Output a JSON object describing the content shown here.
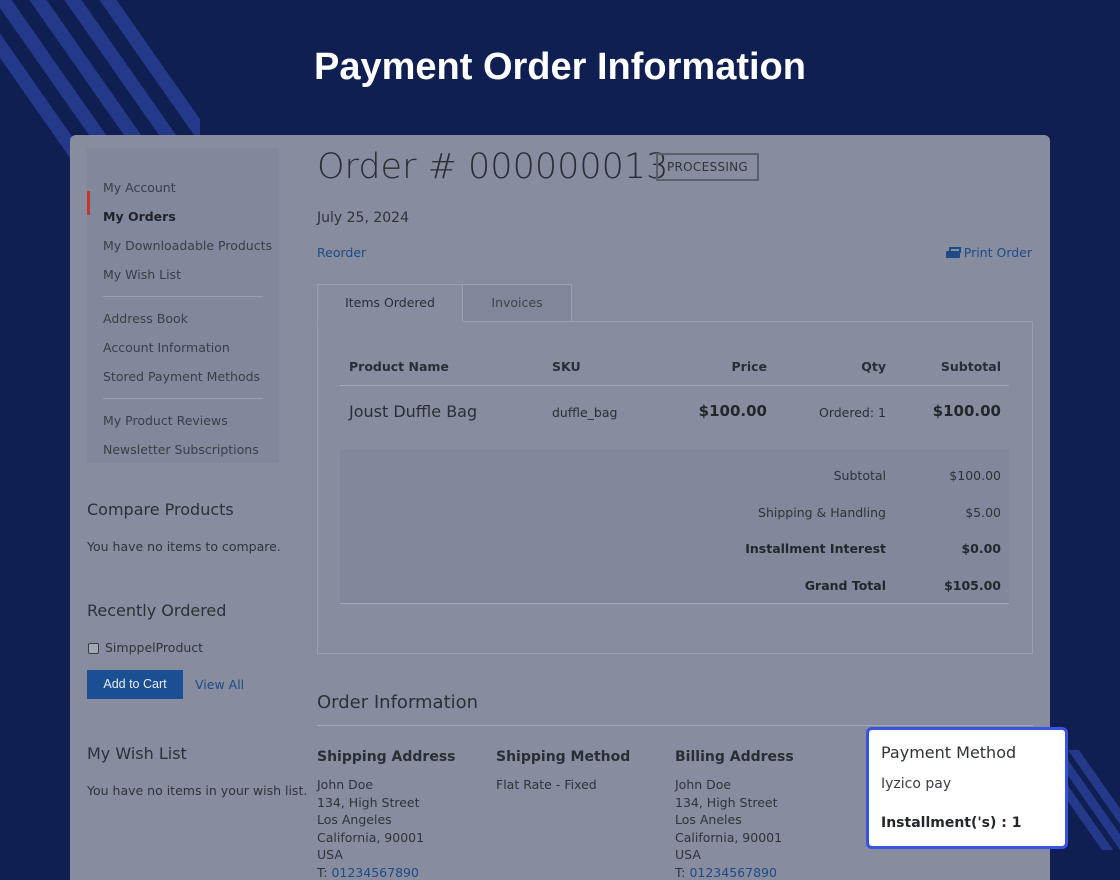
{
  "hero": {
    "title": "Payment Order Information"
  },
  "sidebar": {
    "items": [
      {
        "label": "My Account",
        "active": false
      },
      {
        "label": "My Orders",
        "active": true
      },
      {
        "label": "My Downloadable Products",
        "active": false
      },
      {
        "label": "My Wish List",
        "active": false
      },
      {
        "label": "Address Book",
        "active": false
      },
      {
        "label": "Account Information",
        "active": false
      },
      {
        "label": "Stored Payment Methods",
        "active": false
      },
      {
        "label": "My Product Reviews",
        "active": false
      },
      {
        "label": "Newsletter Subscriptions",
        "active": false
      }
    ]
  },
  "compare": {
    "title": "Compare Products",
    "empty_text": "You have no items to compare."
  },
  "recently_ordered": {
    "title": "Recently Ordered",
    "product": "SimppelProduct",
    "add_to_cart": "Add to Cart",
    "view_all": "View All"
  },
  "wishlist": {
    "title": "My Wish List",
    "empty_text": "You have no items in your wish list."
  },
  "order": {
    "title": "Order # 000000013",
    "status": "PROCESSING",
    "date": "July 25, 2024",
    "reorder": "Reorder",
    "print": "Print Order"
  },
  "tabs": [
    {
      "label": "Items Ordered",
      "active": true
    },
    {
      "label": "Invoices",
      "active": false
    }
  ],
  "items_table": {
    "headers": {
      "product": "Product Name",
      "sku": "SKU",
      "price": "Price",
      "qty": "Qty",
      "subtotal": "Subtotal"
    },
    "rows": [
      {
        "product": "Joust Duffle Bag",
        "sku": "duffle_bag",
        "price": "$100.00",
        "qty": "Ordered: 1",
        "subtotal": "$100.00"
      }
    ]
  },
  "totals": [
    {
      "label": "Subtotal",
      "value": "$100.00",
      "bold": false
    },
    {
      "label": "Shipping & Handling",
      "value": "$5.00",
      "bold": false
    },
    {
      "label": "Installment Interest",
      "value": "$0.00",
      "bold": true
    },
    {
      "label": "Grand Total",
      "value": "$105.00",
      "bold": true
    }
  ],
  "order_info": {
    "title": "Order Information",
    "shipping_address": {
      "heading": "Shipping Address",
      "lines": [
        "John Doe",
        "134, High Street",
        "Los Angeles",
        "California, 90001",
        "USA"
      ],
      "phone_prefix": "T: ",
      "phone": "01234567890"
    },
    "shipping_method": {
      "heading": "Shipping Method",
      "value": "Flat Rate - Fixed"
    },
    "billing_address": {
      "heading": "Billing Address",
      "lines": [
        "John Doe",
        "134, High Street",
        "Los Aneles",
        "California, 90001",
        "USA"
      ],
      "phone_prefix": "T: ",
      "phone": "01234567890"
    },
    "payment_method": {
      "heading": "Payment Method",
      "value": "Iyzico pay",
      "installment": "Installment('s) : 1"
    }
  },
  "colors": {
    "background": "#101f52",
    "accent_border": "#3753e0",
    "link": "#1e4a88",
    "button": "#1a4f93",
    "active_marker": "#c0392b"
  }
}
